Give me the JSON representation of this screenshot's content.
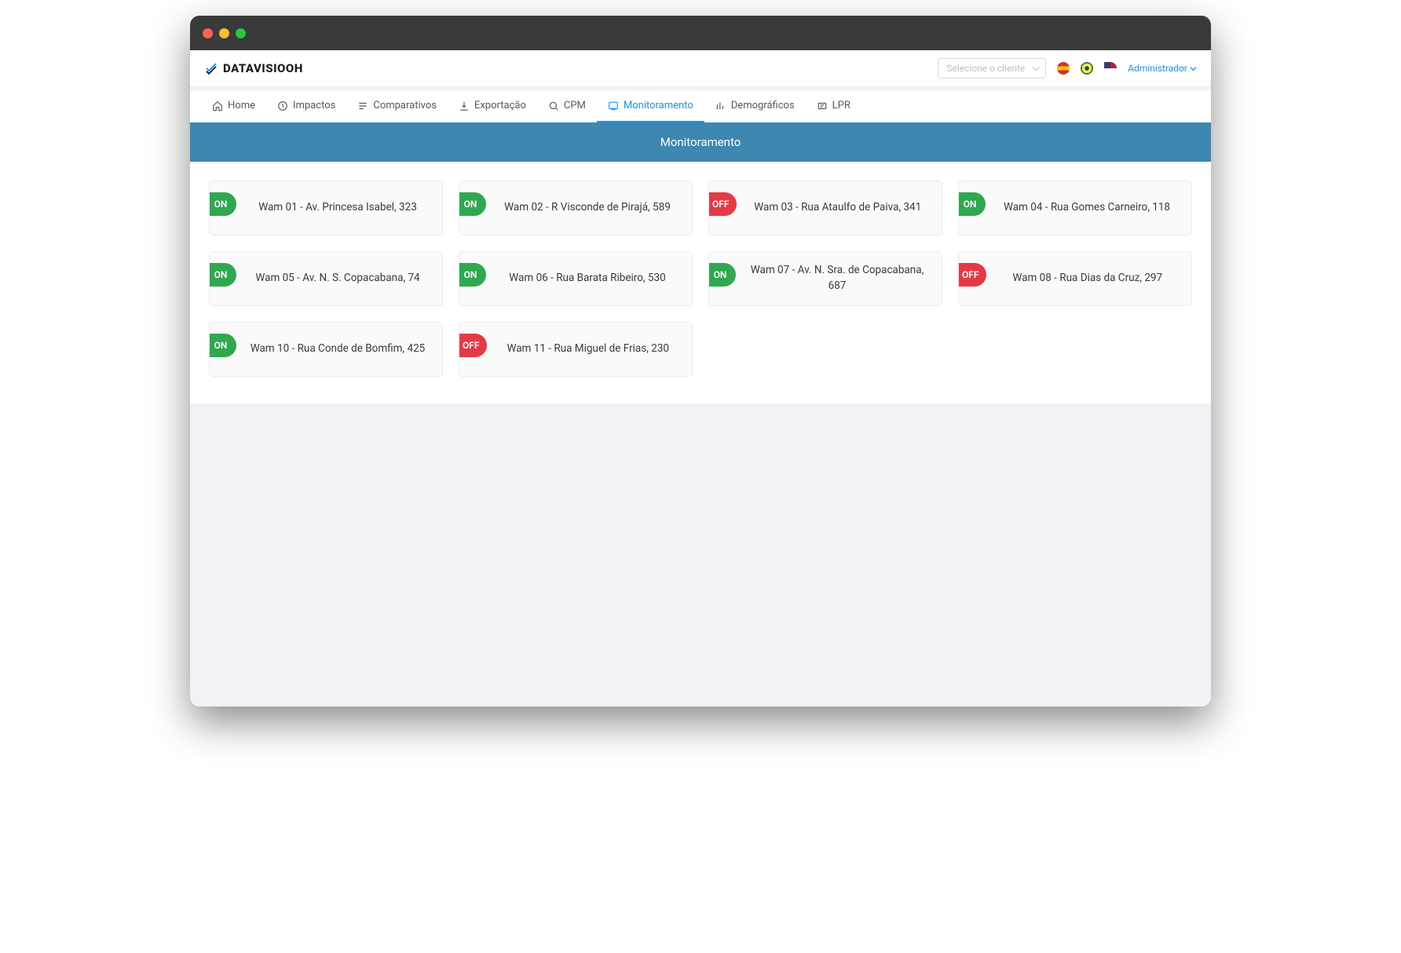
{
  "brand": "DATAVISIOOH",
  "clientSelect": {
    "placeholder": "Selecione o cliente"
  },
  "user": {
    "label": "Administrador"
  },
  "tabs": [
    {
      "id": "home",
      "label": "Home"
    },
    {
      "id": "impactos",
      "label": "Impactos"
    },
    {
      "id": "comparativos",
      "label": "Comparativos"
    },
    {
      "id": "exportacao",
      "label": "Exportação"
    },
    {
      "id": "cpm",
      "label": "CPM"
    },
    {
      "id": "monitoramento",
      "label": "Monitoramento"
    },
    {
      "id": "demograficos",
      "label": "Demográficos"
    },
    {
      "id": "lpr",
      "label": "LPR"
    }
  ],
  "activeTabId": "monitoramento",
  "banner": {
    "title": "Monitoramento"
  },
  "statusLabels": {
    "on": "ON",
    "off": "OFF"
  },
  "cards": [
    {
      "status": "on",
      "label": "Wam 01 - Av. Princesa Isabel, 323"
    },
    {
      "status": "on",
      "label": "Wam 02 - R Visconde de Pirajá, 589"
    },
    {
      "status": "off",
      "label": "Wam 03 - Rua Ataulfo de Paiva, 341"
    },
    {
      "status": "on",
      "label": "Wam 04 - Rua Gomes Carneiro, 118"
    },
    {
      "status": "on",
      "label": "Wam 05 - Av. N. S. Copacabana, 74"
    },
    {
      "status": "on",
      "label": "Wam 06 - Rua Barata Ribeiro, 530"
    },
    {
      "status": "on",
      "label": "Wam 07 - Av. N. Sra. de Copacabana, 687"
    },
    {
      "status": "off",
      "label": "Wam 08 - Rua Dias da Cruz, 297"
    },
    {
      "status": "on",
      "label": "Wam 10 - Rua Conde de Bomfim, 425"
    },
    {
      "status": "off",
      "label": "Wam 11 - Rua Miguel de Frias, 230"
    }
  ]
}
